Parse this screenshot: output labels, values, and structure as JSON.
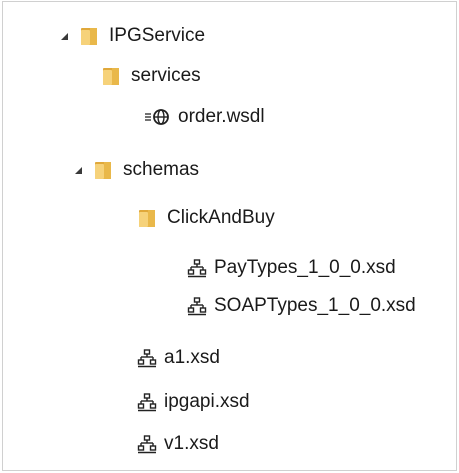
{
  "tree": {
    "root": {
      "label": "IPGService"
    },
    "services": {
      "label": "services"
    },
    "order_wsdl": {
      "label": "order.wsdl"
    },
    "schemas": {
      "label": "schemas"
    },
    "clickandbuy": {
      "label": "ClickAndBuy"
    },
    "paytypes": {
      "label": "PayTypes_1_0_0.xsd"
    },
    "soaptypes": {
      "label": "SOAPTypes_1_0_0.xsd"
    },
    "a1": {
      "label": "a1.xsd"
    },
    "ipgapi": {
      "label": "ipgapi.xsd"
    },
    "v1": {
      "label": "v1.xsd"
    }
  },
  "icons": {
    "folder": "folder-icon",
    "wsdl": "web-service-icon",
    "xsd": "xml-schema-icon",
    "expand": "expanded-triangle-icon"
  },
  "colors": {
    "folder_body": "#e9b84a",
    "folder_front": "#f6d27a",
    "arrow": "#3a3a3a",
    "text": "#1a1a1a"
  }
}
